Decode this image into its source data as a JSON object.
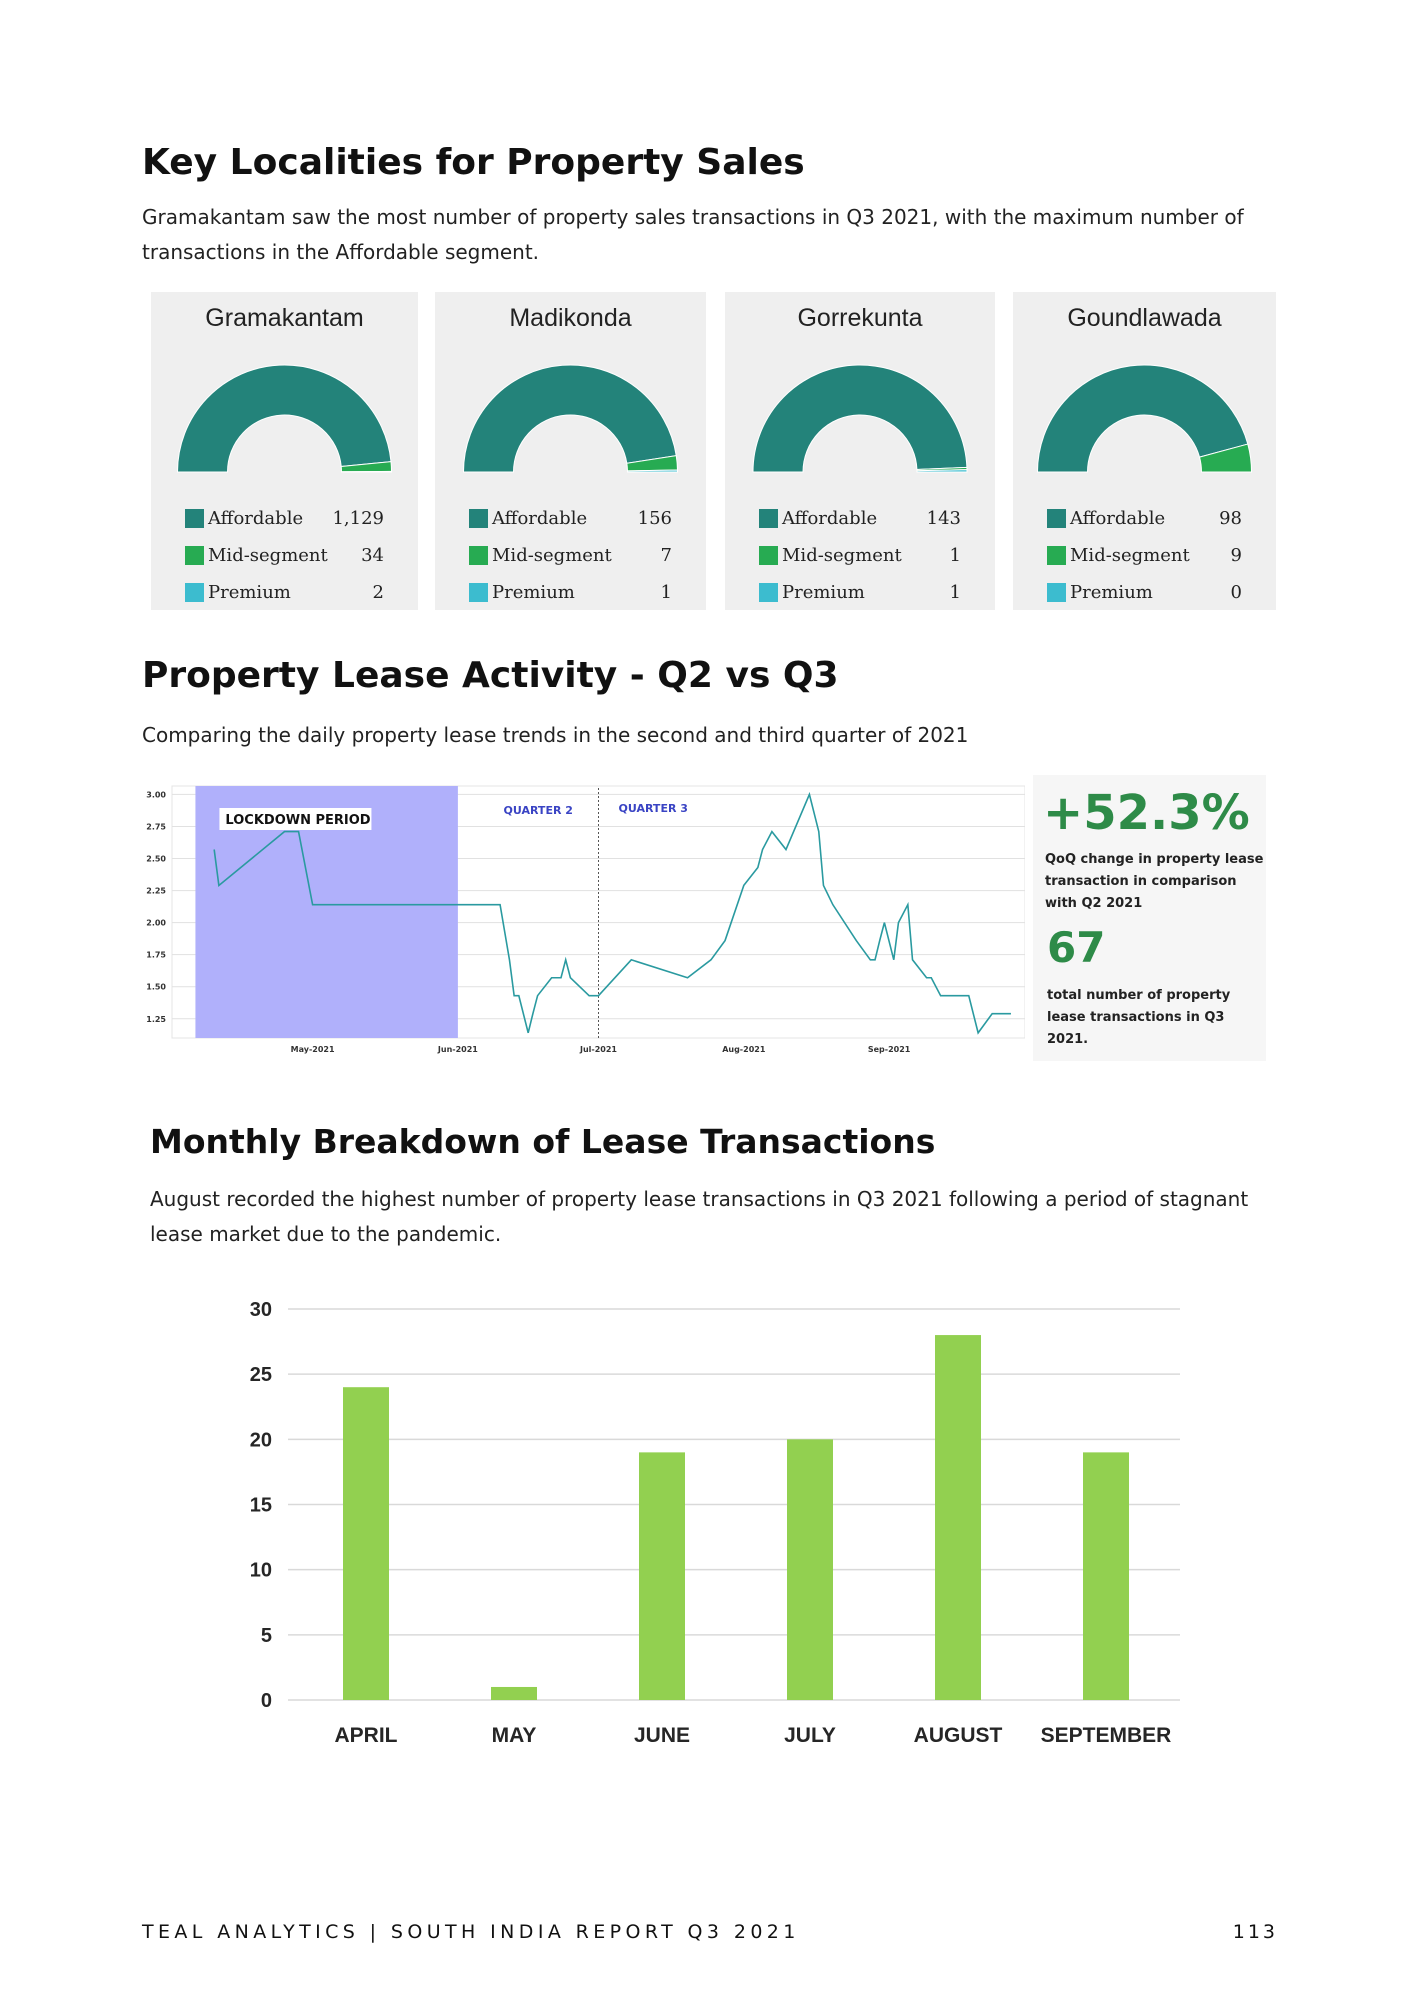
{
  "sales_section": {
    "title": "Key Localities for Property Sales",
    "description": "Gramakantam saw the most number of property sales transactions in Q3 2021, with the maximum number of transactions in the Affordable segment."
  },
  "colors": {
    "affordable": "#23837a",
    "mid_segment": "#27ab52",
    "premium": "#3cbccf",
    "stat_green": "#2e8b48",
    "bar_green": "#92d050",
    "lockdown": "#b0b0fb",
    "line_teal": "#2a9aa0"
  },
  "localities": [
    {
      "name": "Gramakantam",
      "segments": [
        {
          "label": "Affordable",
          "display": "1,129",
          "value": 1129
        },
        {
          "label": "Mid-segment",
          "display": "34",
          "value": 34
        },
        {
          "label": "Premium",
          "display": "2",
          "value": 2
        }
      ]
    },
    {
      "name": "Madikonda",
      "segments": [
        {
          "label": "Affordable",
          "display": "156",
          "value": 156
        },
        {
          "label": "Mid-segment",
          "display": "7",
          "value": 7
        },
        {
          "label": "Premium",
          "display": "1",
          "value": 1
        }
      ]
    },
    {
      "name": "Gorrekunta",
      "segments": [
        {
          "label": "Affordable",
          "display": "143",
          "value": 143
        },
        {
          "label": "Mid-segment",
          "display": "1",
          "value": 1
        },
        {
          "label": "Premium",
          "display": "1",
          "value": 1
        }
      ]
    },
    {
      "name": "Goundlawada",
      "segments": [
        {
          "label": "Affordable",
          "display": "98",
          "value": 98
        },
        {
          "label": "Mid-segment",
          "display": "9",
          "value": 9
        },
        {
          "label": "Premium",
          "display": "0",
          "value": 0
        }
      ]
    }
  ],
  "lease_section": {
    "title": "Property Lease Activity - Q2 vs Q3",
    "description": "Comparing the daily property lease trends in the second and third quarter of 2021",
    "qoq_change": "+52.3%",
    "qoq_desc": [
      "QoQ change in property lease",
      "transaction in comparison",
      "with Q2 2021"
    ],
    "total": "67",
    "total_desc": [
      "total number of property",
      "lease transactions in Q3",
      "2021."
    ]
  },
  "monthly_section": {
    "title": "Monthly Breakdown of Lease Transactions",
    "description": "August recorded the highest number of property lease transactions in Q3 2021 following a period of stagnant lease market due to the pandemic."
  },
  "chart_data": [
    {
      "type": "line",
      "title": "",
      "x_tick_labels": [
        "May-2021",
        "Jun-2021",
        "Jul-2021",
        "Aug-2021",
        "Sep-2021"
      ],
      "y_ticks": [
        "3.00",
        "2.75",
        "2.50",
        "2.25",
        "2.00",
        "1.75",
        "1.50",
        "1.25"
      ],
      "ylim": [
        1.1,
        3.05
      ],
      "xlim": [
        "2021-04-01",
        "2021-09-30"
      ],
      "annotations": [
        "LOCKDOWN PERIOD",
        "QUARTER 2",
        "QUARTER 3"
      ],
      "lockdown_range": [
        "2021-04-06",
        "2021-06-01"
      ],
      "quarter_divider": "2021-07-01",
      "grid": true,
      "series": [
        {
          "x": [
            "2021-04-10",
            "2021-04-11",
            "2021-04-25",
            "2021-04-28",
            "2021-05-01",
            "2021-06-10",
            "2021-06-12",
            "2021-06-13",
            "2021-06-14",
            "2021-06-16",
            "2021-06-17",
            "2021-06-18",
            "2021-06-21",
            "2021-06-22",
            "2021-06-23",
            "2021-06-24",
            "2021-06-25",
            "2021-06-29",
            "2021-06-30",
            "2021-07-01",
            "2021-07-08",
            "2021-07-20",
            "2021-07-25",
            "2021-07-28",
            "2021-08-01",
            "2021-08-04",
            "2021-08-05",
            "2021-08-07",
            "2021-08-10",
            "2021-08-15",
            "2021-08-17",
            "2021-08-18",
            "2021-08-20",
            "2021-08-25",
            "2021-08-28",
            "2021-08-29",
            "2021-08-30",
            "2021-08-31",
            "2021-09-02",
            "2021-09-03",
            "2021-09-05",
            "2021-09-06",
            "2021-09-09",
            "2021-09-10",
            "2021-09-12",
            "2021-09-13",
            "2021-09-14",
            "2021-09-18",
            "2021-09-20",
            "2021-09-23",
            "2021-09-25",
            "2021-09-27"
          ],
          "y": [
            2.57,
            2.29,
            2.71,
            2.71,
            2.14,
            2.14,
            1.71,
            1.43,
            1.43,
            1.14,
            1.29,
            1.43,
            1.57,
            1.57,
            1.57,
            1.71,
            1.57,
            1.43,
            1.43,
            1.43,
            1.71,
            1.57,
            1.71,
            1.86,
            2.29,
            2.43,
            2.57,
            2.71,
            2.57,
            3.0,
            2.71,
            2.29,
            2.14,
            1.86,
            1.71,
            1.71,
            1.86,
            2.0,
            1.71,
            2.0,
            2.14,
            1.71,
            1.57,
            1.57,
            1.43,
            1.43,
            1.43,
            1.43,
            1.14,
            1.29,
            1.29,
            1.29
          ]
        }
      ]
    },
    {
      "type": "bar",
      "title": "",
      "xlabel": "",
      "ylabel": "",
      "categories": [
        "APRIL",
        "MAY",
        "JUNE",
        "JULY",
        "AUGUST",
        "SEPTEMBER"
      ],
      "values": [
        24,
        1,
        19,
        20,
        28,
        19
      ],
      "ylim": [
        0,
        30
      ],
      "y_ticks": [
        0,
        5,
        10,
        15,
        20,
        25,
        30
      ],
      "grid": true
    }
  ],
  "footer": {
    "report": "TEAL ANALYTICS | SOUTH INDIA REPORT Q3 2021",
    "page": "113"
  }
}
